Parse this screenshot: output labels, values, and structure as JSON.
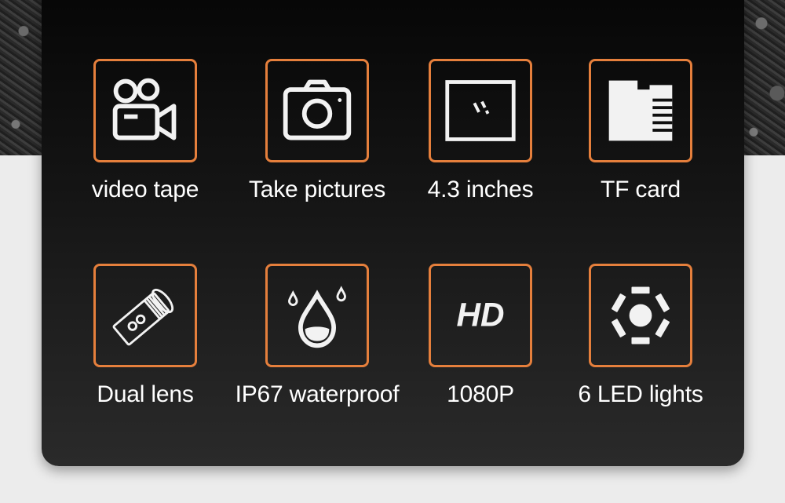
{
  "colors": {
    "accent": "#e57f3c",
    "panel": "#0d0d0d",
    "icon": "#f2f2f2",
    "text": "#ffffff"
  },
  "features": [
    {
      "label": "video tape",
      "icon": "video-camera-icon"
    },
    {
      "label": "Take pictures",
      "icon": "camera-icon"
    },
    {
      "label": "4.3 inches",
      "icon": "screen-icon"
    },
    {
      "label": "TF card",
      "icon": "sd-card-icon"
    },
    {
      "label": "Dual lens",
      "icon": "dual-lens-icon"
    },
    {
      "label": "IP67 waterproof",
      "icon": "water-drop-icon"
    },
    {
      "label": "1080P",
      "icon": "hd-icon",
      "icon_text": "HD"
    },
    {
      "label": "6 LED lights",
      "icon": "led-lights-icon"
    }
  ]
}
